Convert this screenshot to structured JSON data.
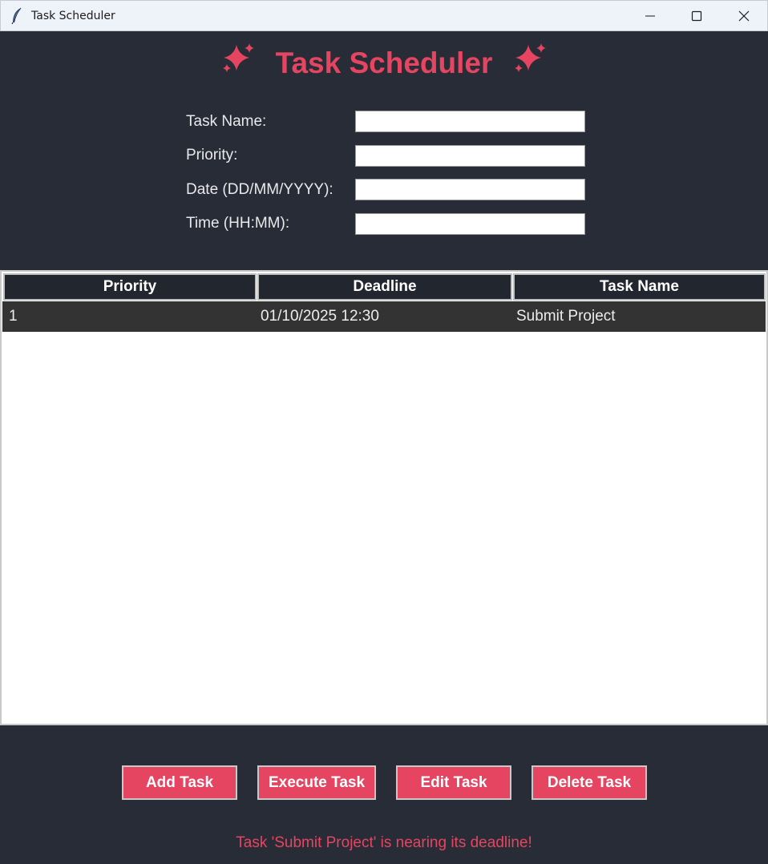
{
  "window": {
    "title": "Task Scheduler",
    "icon": "feather-icon",
    "controls": [
      "minimize-icon",
      "maximize-icon",
      "close-icon"
    ]
  },
  "header": {
    "title": "Task Scheduler",
    "icon_left": "sparkles-icon",
    "icon_right": "sparkles-icon",
    "color": "#e64561"
  },
  "form": {
    "task_name_label": "Task Name:",
    "task_name_value": "",
    "priority_label": "Priority:",
    "priority_value": "",
    "date_label": "Date (DD/MM/YYYY):",
    "date_value": "",
    "time_label": "Time (HH:MM):",
    "time_value": ""
  },
  "table": {
    "columns": [
      "Priority",
      "Deadline",
      "Task Name"
    ],
    "rows": [
      {
        "priority": "1",
        "deadline": "01/10/2025 12:30",
        "task_name": "Submit Project"
      }
    ]
  },
  "buttons": {
    "add": "Add Task",
    "execute": "Execute Task",
    "edit": "Edit Task",
    "delete": "Delete Task"
  },
  "status": {
    "message": "Task 'Submit Project' is nearing its deadline!"
  },
  "colors": {
    "background": "#282c36",
    "accent": "#e64561",
    "header_bg": "#22262e",
    "row_bg": "#333333"
  }
}
